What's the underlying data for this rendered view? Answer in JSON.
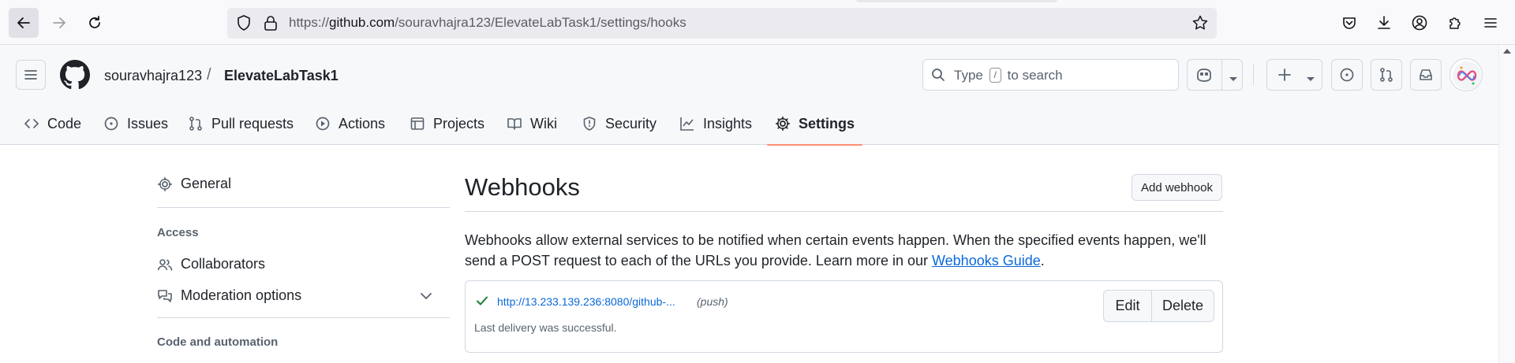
{
  "browser": {
    "url_prefix": "https://",
    "url_host": "github.com",
    "url_path": "/souravhajra123/ElevateLabTask1/settings/hooks"
  },
  "header": {
    "owner": "souravhajra123",
    "separator": "/",
    "repo": "ElevateLabTask1",
    "search_pre": "Type",
    "search_key": "/",
    "search_post": "to search"
  },
  "tabs": [
    {
      "label": "Code",
      "icon": "code-icon"
    },
    {
      "label": "Issues",
      "icon": "issue-icon"
    },
    {
      "label": "Pull requests",
      "icon": "pull-request-icon"
    },
    {
      "label": "Actions",
      "icon": "play-icon"
    },
    {
      "label": "Projects",
      "icon": "table-icon"
    },
    {
      "label": "Wiki",
      "icon": "book-icon"
    },
    {
      "label": "Security",
      "icon": "shield-icon"
    },
    {
      "label": "Insights",
      "icon": "graph-icon"
    },
    {
      "label": "Settings",
      "icon": "gear-icon",
      "active": true
    }
  ],
  "sidebar": {
    "general": "General",
    "access_heading": "Access",
    "collaborators": "Collaborators",
    "moderation": "Moderation options",
    "code_heading": "Code and automation"
  },
  "main": {
    "title": "Webhooks",
    "add_button": "Add webhook",
    "description": "Webhooks allow external services to be notified when certain events happen. When the specified events happen, we'll send a POST request to each of the URLs you provide. Learn more in our ",
    "guide_link": "Webhooks Guide",
    "period": ".",
    "hook": {
      "url": "http://13.233.139.236:8080/github-...",
      "event": "(push)",
      "status": "Last delivery was successful.",
      "edit": "Edit",
      "delete": "Delete"
    }
  },
  "colors": {
    "accent_underline": "#fd8c73",
    "link": "#0969da",
    "success": "#1a7f37"
  }
}
